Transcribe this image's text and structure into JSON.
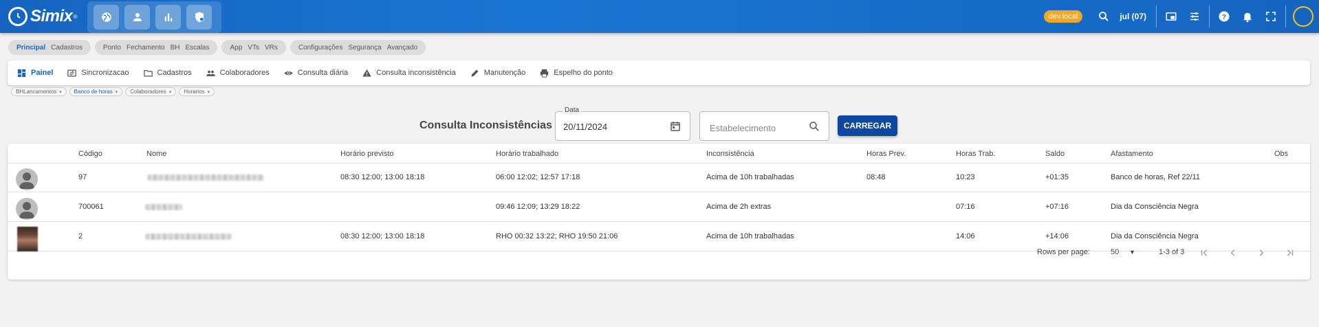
{
  "app": {
    "logo_text": "Simix",
    "logo_reg": "®"
  },
  "topbar": {
    "module_icons": [
      "globe-icon",
      "person-icon",
      "bar-chart-icon",
      "shield-lock-icon"
    ],
    "env_badge": "dev.local",
    "date_label": "jul (07)",
    "tools": [
      "search-icon",
      "picture-in-picture-icon",
      "sliders-icon",
      "help-icon",
      "bell-icon",
      "fullscreen-icon"
    ],
    "accent": "#1565c0",
    "badge_color": "#f5a623"
  },
  "module_tabs": [
    {
      "items": [
        "Principal",
        "Cadastros"
      ],
      "active": "Principal"
    },
    {
      "items": [
        "Ponto",
        "Fechamento",
        "BH",
        "Escalas"
      ]
    },
    {
      "items": [
        "App",
        "VTs",
        "VRs"
      ]
    },
    {
      "items": [
        "Configurações",
        "Segurança",
        "Avançado"
      ]
    }
  ],
  "menu": [
    {
      "label": "Painel",
      "icon": "dashboard-icon",
      "active": true
    },
    {
      "label": "Sincronizacao",
      "icon": "sync-icon"
    },
    {
      "label": "Cadastros",
      "icon": "folder-icon"
    },
    {
      "label": "Colaboradores",
      "icon": "people-icon"
    },
    {
      "label": "Consulta diária",
      "icon": "eye-icon"
    },
    {
      "label": "Consulta inconsistência",
      "icon": "warning-icon"
    },
    {
      "label": "Manutenção",
      "icon": "pencil-icon"
    },
    {
      "label": "Espelho do ponto",
      "icon": "printer-icon"
    }
  ],
  "chips": [
    {
      "label": "BHLancamentos"
    },
    {
      "label": "Banco de horas",
      "active": true
    },
    {
      "label": "Colaboradores"
    },
    {
      "label": "Horarios"
    }
  ],
  "filter": {
    "title": "Consulta Inconsistências",
    "date_label": "Data",
    "date_value": "20/11/2024",
    "estab_placeholder": "Estabelecimento",
    "load_label": "CARREGAR"
  },
  "table": {
    "headers": [
      "Código",
      "Nome",
      "Horário previsto",
      "Horário trabalhado",
      "Inconsistência",
      "Horas Prev.",
      "Horas Trab.",
      "Saldo",
      "Afastamento",
      "Obs"
    ],
    "rows": [
      {
        "codigo": "97",
        "previsto": "08:30 12:00; 13:00 18:18",
        "trabalhado": "06:00 12:02; 12:57 17:18",
        "inconsistencia": "Acima de 10h trabalhadas",
        "horas_prev": "08:48",
        "horas_trab": "10:23",
        "saldo": "+01:35",
        "afastamento": "Banco de horas, Ref 22/11",
        "obs": ""
      },
      {
        "codigo": "700061",
        "previsto": "",
        "trabalhado": "09:46 12:09; 13:29 18:22",
        "inconsistencia": "Acima de 2h extras",
        "horas_prev": "",
        "horas_trab": "07:16",
        "saldo": "+07:16",
        "afastamento": "Dia da Consciência Negra",
        "obs": ""
      },
      {
        "codigo": "2",
        "previsto": "08:30 12:00; 13:00 18:18",
        "trabalhado": "RHO 00:32 13:22; RHO 19:50 21:06",
        "inconsistencia": "Acima de 10h trabalhadas",
        "horas_prev": "",
        "horas_trab": "14:06",
        "saldo": "+14:06",
        "afastamento": "Dia da Consciência Negra",
        "obs": ""
      }
    ],
    "footer": {
      "rows_per_page_label": "Rows per page:",
      "rows_per_page": "50",
      "range": "1-3 of 3"
    }
  }
}
